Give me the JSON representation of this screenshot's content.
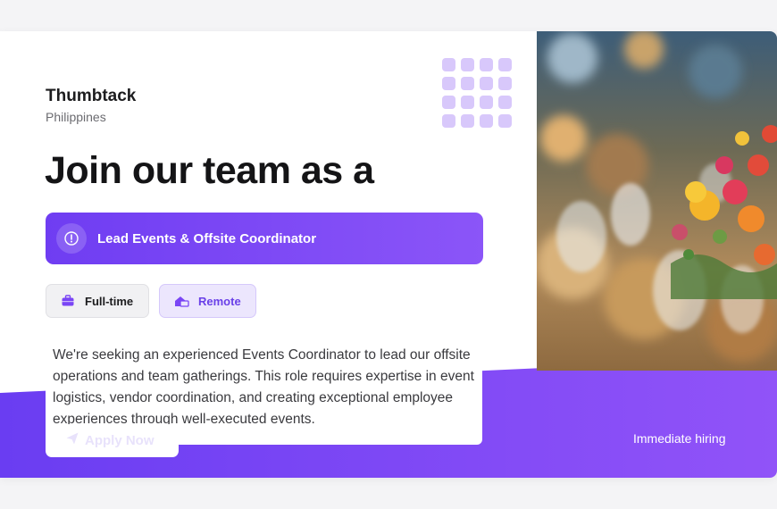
{
  "company": {
    "name": "Thumbtack",
    "location": "Philippines"
  },
  "headline": "Join our team as a",
  "role": {
    "title": "Lead Events & Offsite Coordinator",
    "icon": "info-circle-icon"
  },
  "tags": [
    {
      "label": "Full-time",
      "icon": "briefcase-icon"
    },
    {
      "label": "Remote",
      "icon": "remote-home-icon"
    }
  ],
  "description": "We're seeking an experienced Events Coordinator to lead our offsite operations and team gatherings. This role requires expertise in event logistics, vendor coordination, and creating exceptional employee experiences through well-executed events.",
  "apply": {
    "label": "Apply Now",
    "icon": "send-icon"
  },
  "footer": {
    "badge": "Immediate hiring"
  },
  "colors": {
    "accent": "#7a45f5",
    "accent_light": "#ece6fd",
    "text": "#141416"
  }
}
